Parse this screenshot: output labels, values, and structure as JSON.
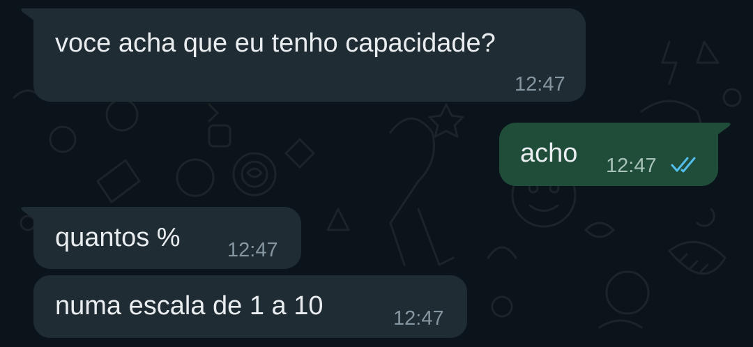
{
  "chat": {
    "messages": [
      {
        "direction": "incoming",
        "text": "voce acha que eu tenho capacidade?",
        "time": "12:47"
      },
      {
        "direction": "outgoing",
        "text": "acho",
        "time": "12:47",
        "status_icon": "double-check-read-icon"
      },
      {
        "direction": "incoming",
        "text": "quantos %",
        "time": "12:47"
      },
      {
        "direction": "incoming",
        "text": "numa escala de 1 a 10",
        "time": "12:47"
      }
    ]
  },
  "colors": {
    "background": "#0b141a",
    "incoming_bubble": "#202c33",
    "outgoing_bubble": "#1f4d3a",
    "text": "#e9edef",
    "timestamp": "#8696a0",
    "read_tick": "#53bdeb"
  }
}
